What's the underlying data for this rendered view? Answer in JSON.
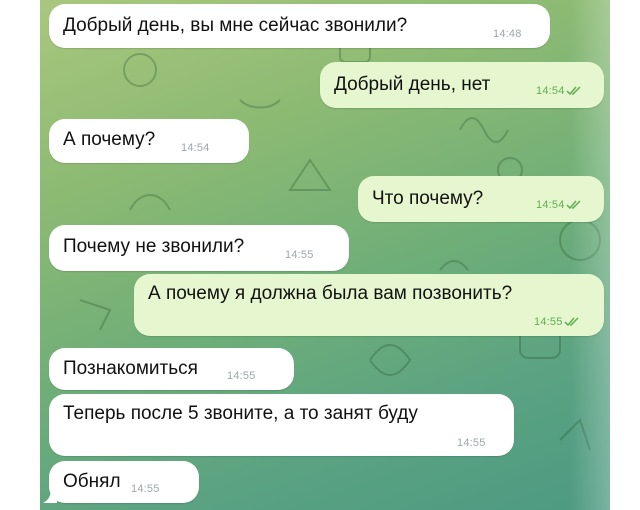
{
  "messages": [
    {
      "dir": "in",
      "text": "Добрый день, вы мне сейчас звонили?",
      "time": "14:48",
      "read": false
    },
    {
      "dir": "out",
      "text": "Добрый день, нет",
      "time": "14:54",
      "read": true
    },
    {
      "dir": "in",
      "text": "А почему?",
      "time": "14:54",
      "read": false
    },
    {
      "dir": "out",
      "text": "Что почему?",
      "time": "14:54",
      "read": true
    },
    {
      "dir": "in",
      "text": "Почему не звонили?",
      "time": "14:55",
      "read": false
    },
    {
      "dir": "out",
      "text": "А почему я должна была вам позвонить?",
      "time": "14:55",
      "read": true
    },
    {
      "dir": "in",
      "text": "Познакомиться",
      "time": "14:55",
      "read": false
    },
    {
      "dir": "in",
      "text": "Теперь после 5 звоните, а то занят буду",
      "time": "14:55",
      "read": false
    },
    {
      "dir": "in",
      "text": "Обнял",
      "time": "14:55",
      "read": false
    }
  ],
  "colors": {
    "incoming_bubble": "#ffffff",
    "outgoing_bubble": "#e6f7cf",
    "outgoing_time": "#5fae4f",
    "incoming_time": "#a0a6ab",
    "background_top": "#a9c77e",
    "background_bottom": "#4d9a82"
  },
  "icons": {
    "read_status": "double-check-icon",
    "wallpaper": "doodle-pattern"
  }
}
